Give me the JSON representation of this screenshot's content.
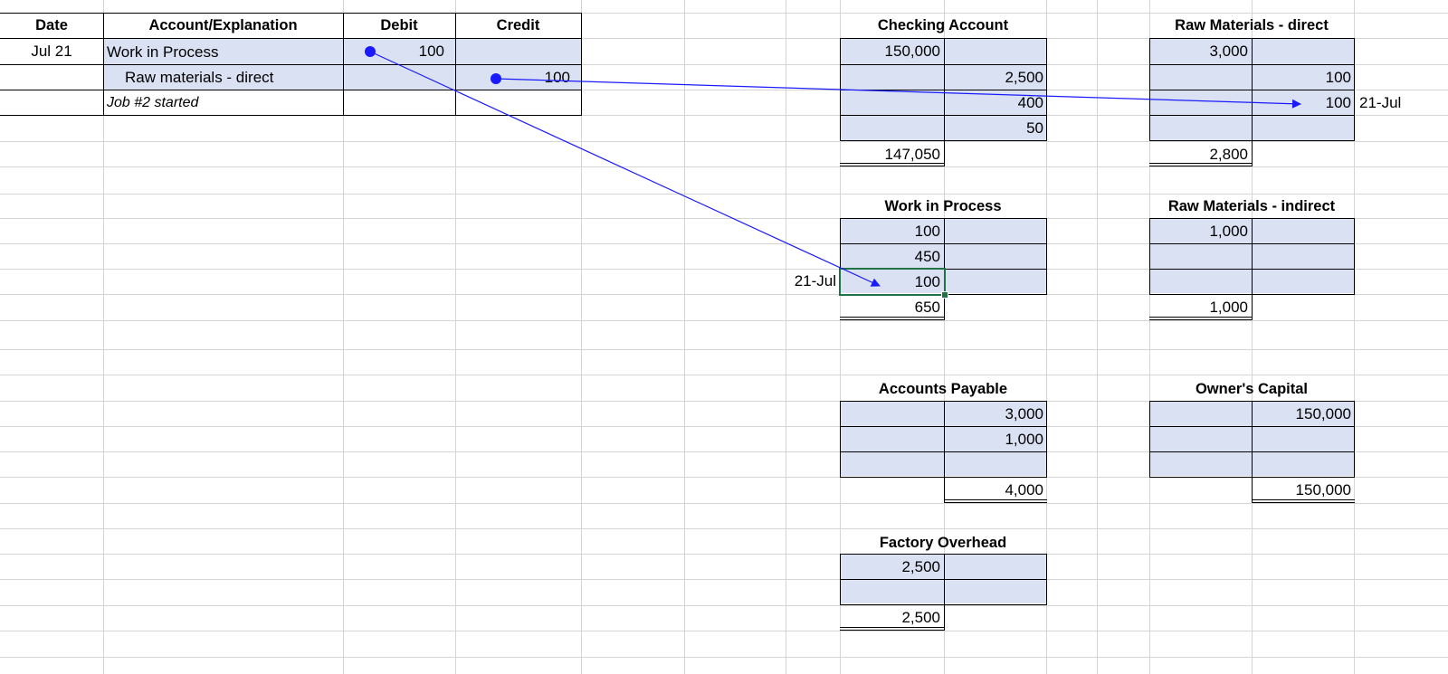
{
  "journal": {
    "headers": {
      "date": "Date",
      "account": "Account/Explanation",
      "debit": "Debit",
      "credit": "Credit"
    },
    "date": "Jul 21",
    "debit_account": "Work in Process",
    "credit_account": "Raw materials - direct",
    "explanation": "Job #2 started",
    "debit_amount": "100",
    "credit_amount": "100"
  },
  "accounts": {
    "checking": {
      "title": "Checking Account",
      "debits": [
        "150,000"
      ],
      "credits": [
        "2,500",
        "400",
        "50"
      ],
      "balance": "147,050"
    },
    "raw_direct": {
      "title": "Raw Materials - direct",
      "debits": [
        "3,000"
      ],
      "credits": [
        "100",
        "100"
      ],
      "balance": "2,800",
      "side_note": "21-Jul"
    },
    "wip": {
      "title": "Work in Process",
      "debits": [
        "100",
        "450",
        "100"
      ],
      "balance": "650",
      "side_note": "21-Jul"
    },
    "raw_indirect": {
      "title": "Raw Materials - indirect",
      "debits": [
        "1,000"
      ],
      "balance": "1,000"
    },
    "ap": {
      "title": "Accounts Payable",
      "credits": [
        "3,000",
        "1,000"
      ],
      "balance": "4,000"
    },
    "capital": {
      "title": "Owner's Capital",
      "credits": [
        "150,000"
      ],
      "balance": "150,000"
    },
    "overhead": {
      "title": "Factory Overhead",
      "debits": [
        "2,500"
      ],
      "balance": "2,500"
    }
  },
  "colors": {
    "account_fill": "#d9e1f2",
    "arrow": "#1a1aff",
    "selection": "#217346",
    "gridline": "#d4d4d4"
  }
}
